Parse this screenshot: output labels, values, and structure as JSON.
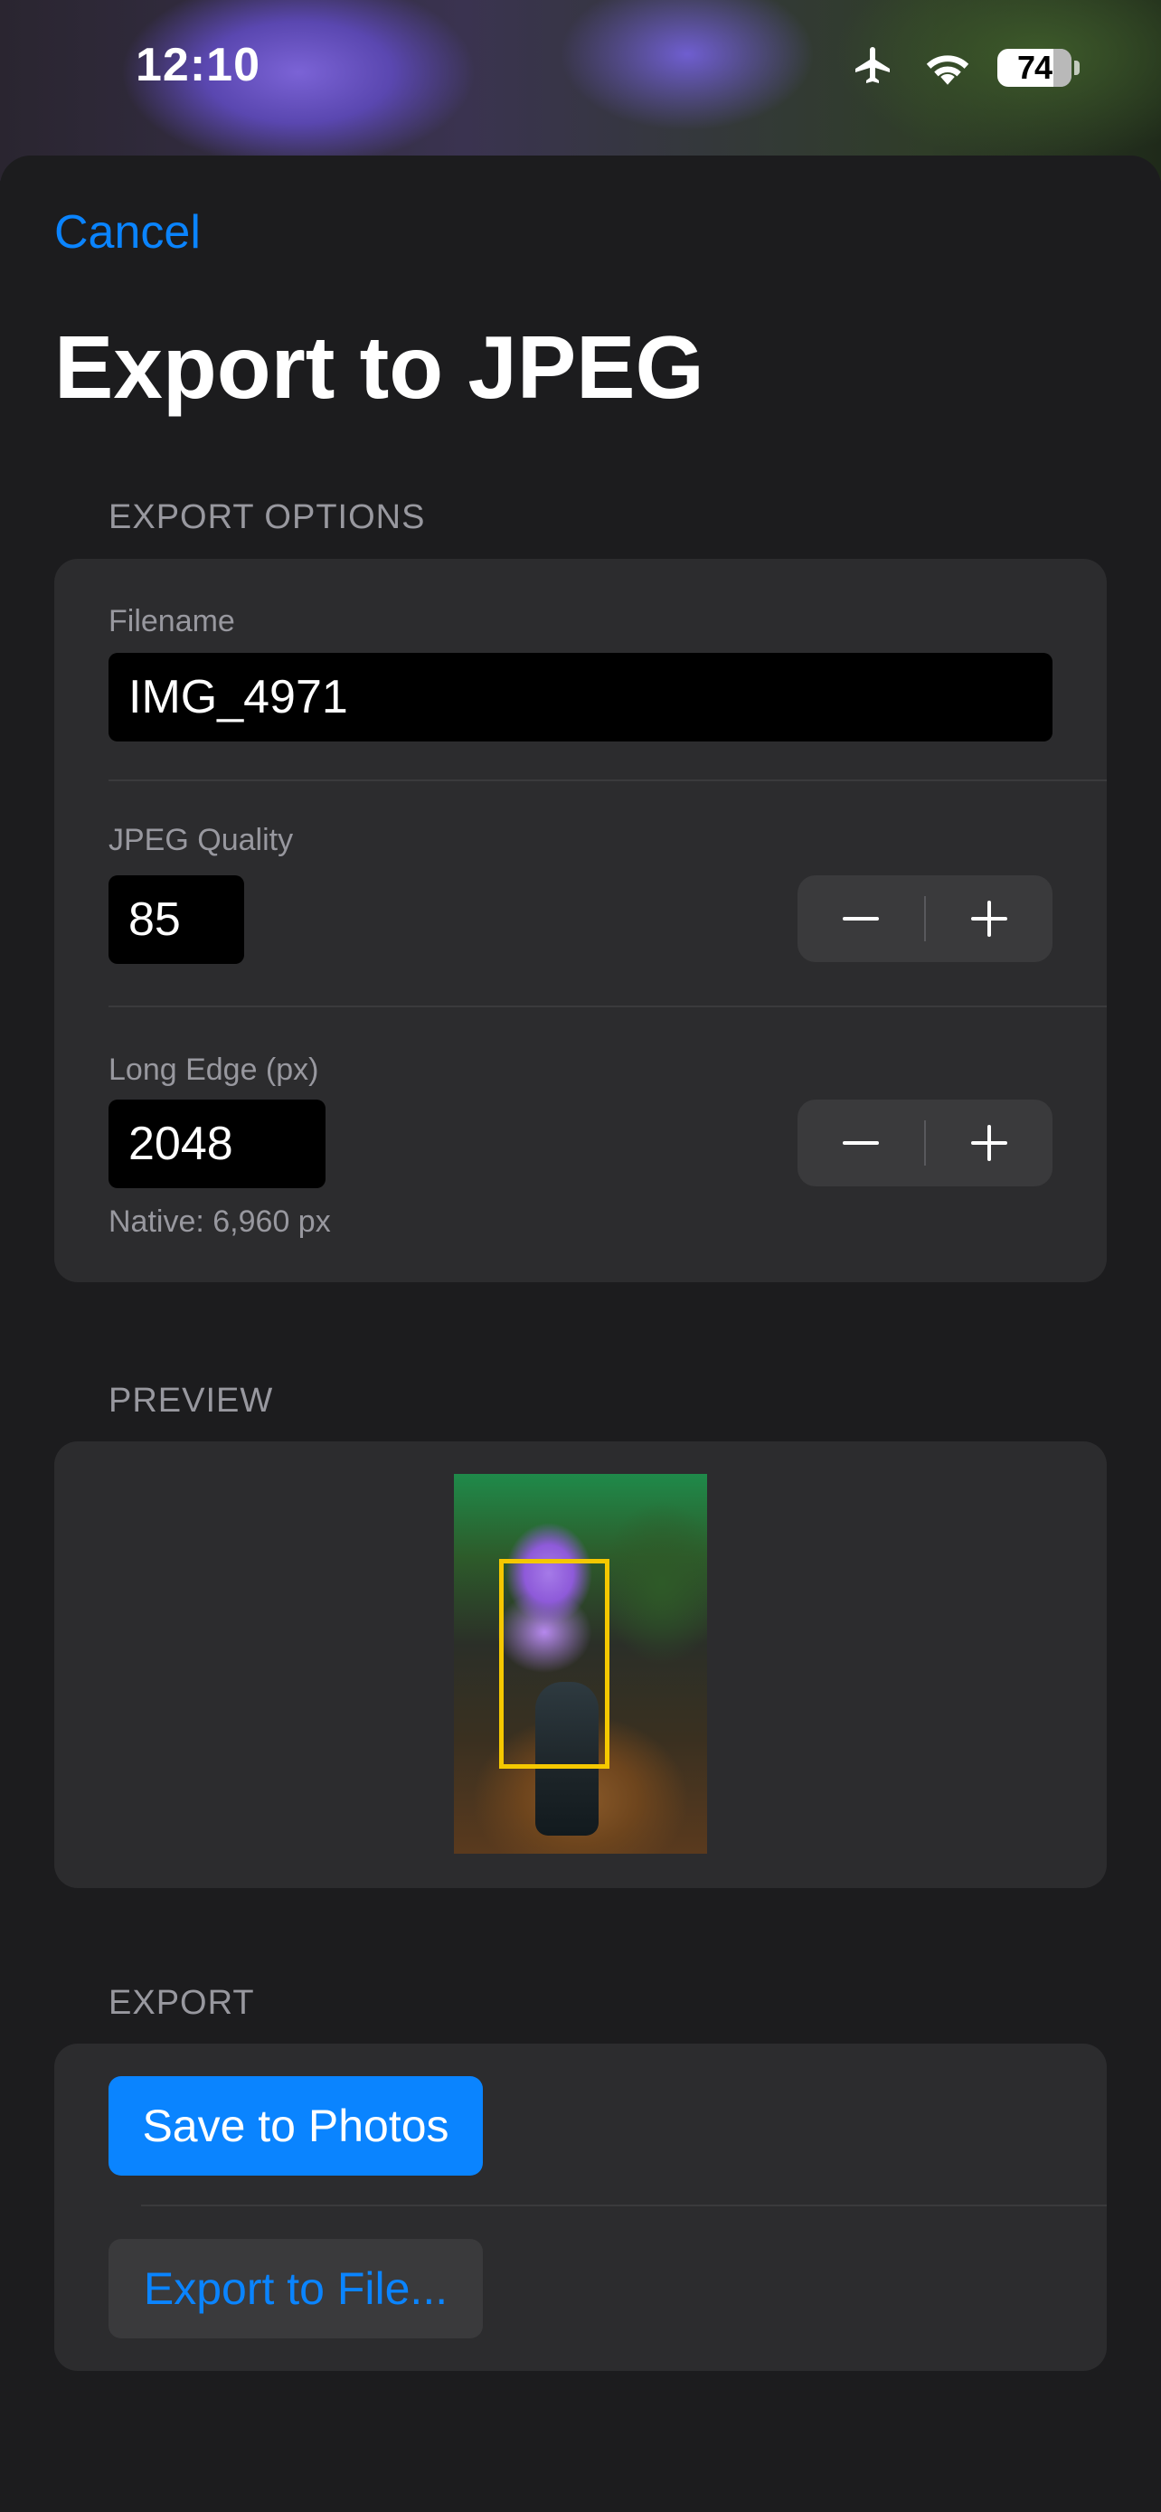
{
  "status_bar": {
    "time": "12:10",
    "battery_percent": "74",
    "airplane_icon": "airplane-icon",
    "wifi_icon": "wifi-icon"
  },
  "navigation": {
    "cancel_label": "Cancel",
    "title": "Export to JPEG"
  },
  "export_options": {
    "section_header": "EXPORT OPTIONS",
    "filename_label": "Filename",
    "filename_value": "IMG_4971",
    "quality_label": "JPEG Quality",
    "quality_value": "85",
    "long_edge_label": "Long Edge (px)",
    "long_edge_value": "2048",
    "native_note": "Native: 6,960 px"
  },
  "preview": {
    "section_header": "PREVIEW"
  },
  "export": {
    "section_header": "EXPORT",
    "save_label": "Save to Photos",
    "export_file_label": "Export to File..."
  },
  "colors": {
    "accent": "#0a84ff",
    "background": "#1c1c1e",
    "group_background": "#2c2c2e",
    "crop_highlight": "#f5c800"
  }
}
